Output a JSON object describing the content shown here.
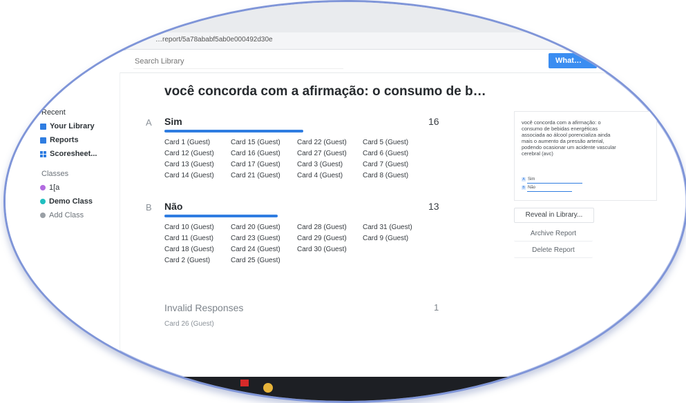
{
  "browser": {
    "url": "…report/5a78ababf5ab0e000492d30e"
  },
  "search": {
    "placeholder": "Search Library",
    "button_label": "What…"
  },
  "sidebar": {
    "items": [
      {
        "label": "Recent",
        "icon": "clock-icon"
      },
      {
        "label": "Your Library",
        "icon": "library-icon"
      },
      {
        "label": "Reports",
        "icon": "report-icon"
      },
      {
        "label": "Scoresheet...",
        "icon": "grid-icon"
      }
    ],
    "classes_header": "Classes",
    "classes": [
      {
        "label": "1[a",
        "color": "#b26be0"
      },
      {
        "label": "Demo Class",
        "color": "#1fbfc0"
      },
      {
        "label": "Add Class",
        "color": "#9aa0a6"
      }
    ]
  },
  "report": {
    "title": "você concorda com a afirmação: o consumo de b…",
    "options": [
      {
        "letter": "A",
        "label": "Sim",
        "count": "16",
        "fraction": 0.552,
        "cards": [
          [
            "Card 1 (Guest)",
            "Card 12 (Guest)",
            "Card 13 (Guest)",
            "Card 14 (Guest)"
          ],
          [
            "Card 15 (Guest)",
            "Card 16 (Guest)",
            "Card 17 (Guest)",
            "Card 21 (Guest)"
          ],
          [
            "Card 22 (Guest)",
            "Card 27 (Guest)",
            "Card 3 (Guest)",
            "Card 4 (Guest)"
          ],
          [
            "Card 5 (Guest)",
            "Card 6 (Guest)",
            "Card 7 (Guest)",
            "Card 8 (Guest)"
          ]
        ]
      },
      {
        "letter": "B",
        "label": "Não",
        "count": "13",
        "fraction": 0.448,
        "cards": [
          [
            "Card 10 (Guest)",
            "Card 11 (Guest)",
            "Card 18 (Guest)",
            "Card 2 (Guest)"
          ],
          [
            "Card 20 (Guest)",
            "Card 23 (Guest)",
            "Card 24 (Guest)",
            "Card 25 (Guest)"
          ],
          [
            "Card 28 (Guest)",
            "Card 29 (Guest)",
            "Card 30 (Guest)"
          ],
          [
            "Card 31 (Guest)",
            "Card 9 (Guest)"
          ]
        ]
      }
    ],
    "invalid": {
      "label": "Invalid Responses",
      "count": "1",
      "cards": [
        "Card 26 (Guest)"
      ]
    }
  },
  "preview": {
    "question": "você concorda com a afirmação: o consumo de bebidas energéticas associada ao álcool porencializa ainda mais o aumento da pressão arterial, podendo ocasionar um acidente vascular cerebral (avc)",
    "options": [
      {
        "letter": "A",
        "label": "Sim"
      },
      {
        "letter": "B",
        "label": "Não"
      }
    ]
  },
  "actions": {
    "reveal": "Reveal in Library...",
    "archive": "Archive Report",
    "delete": "Delete Report"
  },
  "colors": {
    "accent": "#2f7de1",
    "frame": "#7f95d8"
  }
}
